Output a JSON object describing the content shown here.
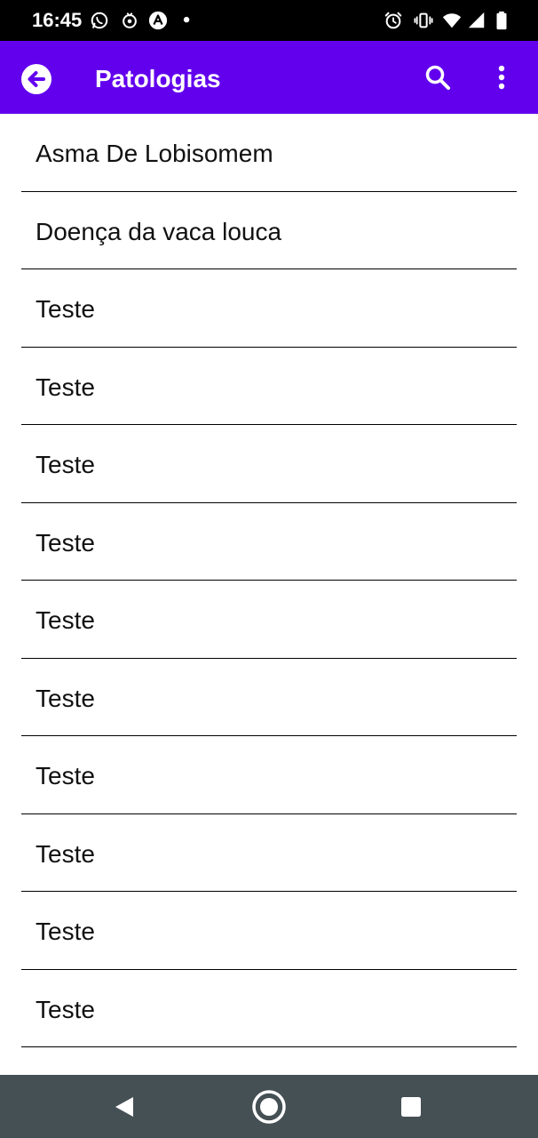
{
  "status_bar": {
    "time": "16:45",
    "icons": [
      "whatsapp-icon",
      "notification-icon",
      "app-icon",
      "dot-icon",
      "alarm-icon",
      "vibrate-icon",
      "wifi-icon",
      "signal-icon",
      "battery-icon"
    ]
  },
  "app_bar": {
    "title": "Patologias",
    "background": "#6200EE",
    "icons": [
      "back-arrow-icon",
      "search-icon",
      "more-vert-icon"
    ]
  },
  "list": {
    "items": [
      {
        "label": "Asma De Lobisomem"
      },
      {
        "label": "Doença da vaca louca"
      },
      {
        "label": "Teste"
      },
      {
        "label": "Teste"
      },
      {
        "label": "Teste"
      },
      {
        "label": "Teste"
      },
      {
        "label": "Teste"
      },
      {
        "label": "Teste"
      },
      {
        "label": "Teste"
      },
      {
        "label": "Teste"
      },
      {
        "label": "Teste"
      },
      {
        "label": "Teste"
      }
    ]
  },
  "nav_bar": {
    "background": "#455055",
    "icons": [
      "nav-back-icon",
      "nav-home-icon",
      "nav-recents-icon"
    ]
  }
}
